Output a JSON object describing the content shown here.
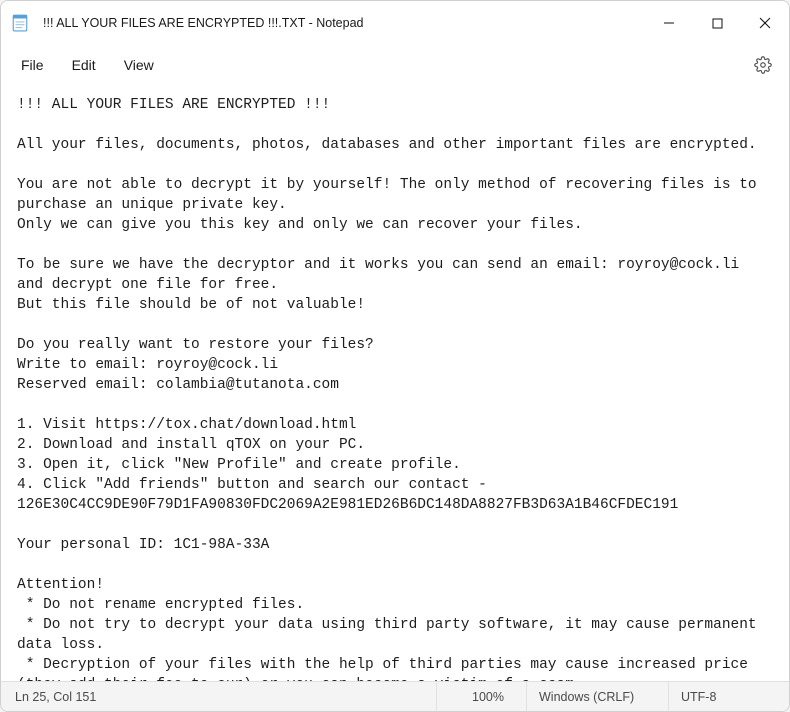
{
  "titlebar": {
    "title": "!!! ALL YOUR FILES ARE ENCRYPTED !!!.TXT - Notepad"
  },
  "menu": {
    "file": "File",
    "edit": "Edit",
    "view": "View"
  },
  "body": "!!! ALL YOUR FILES ARE ENCRYPTED !!!\n\nAll your files, documents, photos, databases and other important files are encrypted.\n\nYou are not able to decrypt it by yourself! The only method of recovering files is to purchase an unique private key.\nOnly we can give you this key and only we can recover your files.\n\nTo be sure we have the decryptor and it works you can send an email: royroy@cock.li and decrypt one file for free.\nBut this file should be of not valuable!\n\nDo you really want to restore your files?\nWrite to email: royroy@cock.li\nReserved email: colambia@tutanota.com\n\n1. Visit https://tox.chat/download.html\n2. Download and install qTOX on your PC.\n3. Open it, click \"New Profile\" and create profile.\n4. Click \"Add friends\" button and search our contact - 126E30C4CC9DE90F79D1FA90830FDC2069A2E981ED26B6DC148DA8827FB3D63A1B46CFDEC191\n\nYour personal ID: 1C1-98A-33A\n\nAttention!\n * Do not rename encrypted files.\n * Do not try to decrypt your data using third party software, it may cause permanent data loss.\n * Decryption of your files with the help of third parties may cause increased price (they add their fee to our) or you can become a victim of a scam.",
  "statusbar": {
    "position": "Ln 25, Col 151",
    "zoom": "100%",
    "eol": "Windows (CRLF)",
    "encoding": "UTF-8"
  }
}
